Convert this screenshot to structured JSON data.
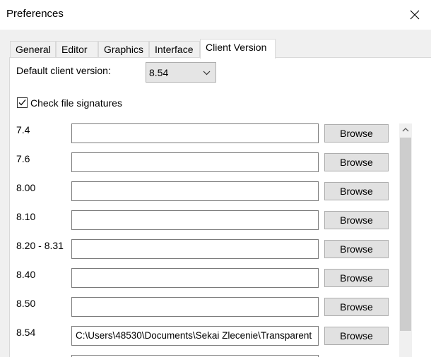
{
  "window": {
    "title": "Preferences"
  },
  "tabs": [
    "General",
    "Editor",
    "Graphics",
    "Interface",
    "Client Version"
  ],
  "active_tab": "Client Version",
  "client_version": {
    "default_label": "Default client version:",
    "default_value": "8.54",
    "check_signatures_label": "Check file signatures",
    "check_signatures_checked": true,
    "browse_label": "Browse",
    "rows": [
      {
        "version": "7.4",
        "path": ""
      },
      {
        "version": "7.6",
        "path": ""
      },
      {
        "version": "8.00",
        "path": ""
      },
      {
        "version": "8.10",
        "path": ""
      },
      {
        "version": "8.20 - 8.31",
        "path": ""
      },
      {
        "version": "8.40",
        "path": ""
      },
      {
        "version": "8.50",
        "path": ""
      },
      {
        "version": "8.54",
        "path": "C:\\Users\\48530\\Documents\\Sekai Zlecenie\\Transparent"
      }
    ]
  },
  "icons": {
    "close": "close-icon",
    "dropdown": "chevron-down-icon",
    "check": "checkmark-icon",
    "scroll_up": "chevron-up-icon"
  }
}
